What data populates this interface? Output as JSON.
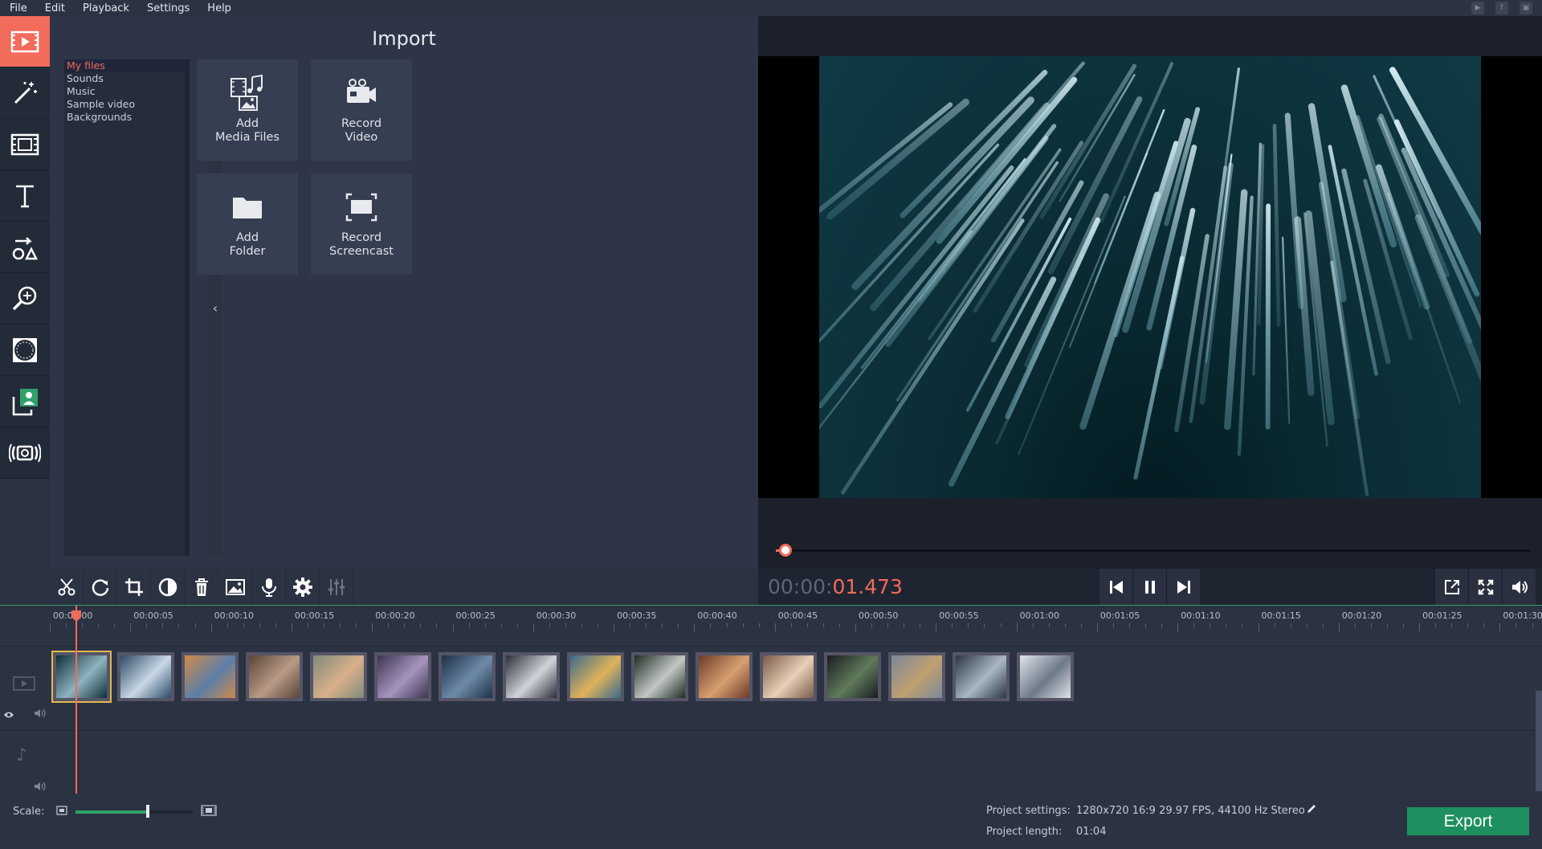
{
  "menu": {
    "items": [
      "File",
      "Edit",
      "Playback",
      "Settings",
      "Help"
    ]
  },
  "social_icons": [
    "youtube-icon",
    "facebook-icon",
    "vk-icon"
  ],
  "sidebar_tools": [
    {
      "name": "import-tool-icon",
      "active": true
    },
    {
      "name": "magic-wand-icon",
      "active": false
    },
    {
      "name": "filmstrip-filters-icon",
      "active": false
    },
    {
      "name": "titles-text-icon",
      "active": false
    },
    {
      "name": "shapes-callouts-icon",
      "active": false
    },
    {
      "name": "zoom-pan-icon",
      "active": false
    },
    {
      "name": "frame-mask-icon",
      "active": false
    },
    {
      "name": "chroma-person-icon",
      "active": false
    },
    {
      "name": "camera-stabilize-icon",
      "active": false
    }
  ],
  "import": {
    "title": "Import",
    "tree": [
      "My files",
      "Sounds",
      "Music",
      "Sample video",
      "Backgrounds"
    ],
    "tree_selected": 0,
    "collapse_glyph": "‹",
    "tiles": [
      {
        "line1": "Add",
        "line2": "Media Files",
        "icon": "add-media-icon"
      },
      {
        "line1": "Record",
        "line2": "Video",
        "icon": "video-camera-icon"
      },
      {
        "line1": "Add",
        "line2": "Folder",
        "icon": "folder-icon"
      },
      {
        "line1": "Record",
        "line2": "Screencast",
        "icon": "screencast-icon"
      }
    ]
  },
  "player": {
    "timecode_dim": "00:00:",
    "timecode_active": "01.473",
    "progress": 0.013
  },
  "edit_tools": [
    "scissors-icon",
    "rotate-icon",
    "crop-icon",
    "color-adjust-icon",
    "trash-icon",
    "image-icon",
    "microphone-icon",
    "gear-icon",
    "equalizer-icon"
  ],
  "timeline": {
    "ticks": [
      "00:00:00",
      "00:00:05",
      "00:00:10",
      "00:00:15",
      "00:00:20",
      "00:00:25",
      "00:00:30",
      "00:00:35",
      "00:00:40",
      "00:00:45",
      "00:00:50",
      "00:00:55",
      "00:01:00",
      "00:01:05",
      "00:01:10",
      "00:01:15",
      "00:01:20",
      "00:01:25",
      "00:01:30"
    ],
    "clips": [
      {
        "c1": "#0e2f38",
        "c2": "#8fb3bf"
      },
      {
        "c1": "#2c4a66",
        "c2": "#c9d8e6"
      },
      {
        "c1": "#d08a4a",
        "c2": "#5b7fa8"
      },
      {
        "c1": "#5a4438",
        "c2": "#b89a86"
      },
      {
        "c1": "#7f8a7a",
        "c2": "#d9b08a"
      },
      {
        "c1": "#3e3450",
        "c2": "#a595c0"
      },
      {
        "c1": "#1d3148",
        "c2": "#6f8aa8"
      },
      {
        "c1": "#2d2f38",
        "c2": "#d0d3da"
      },
      {
        "c1": "#3a6a8c",
        "c2": "#e0b25a"
      },
      {
        "c1": "#1f2c24",
        "c2": "#c3c8c4"
      },
      {
        "c1": "#6b3a2a",
        "c2": "#d8a070"
      },
      {
        "c1": "#7a5a48",
        "c2": "#e8d0b8"
      },
      {
        "c1": "#1a1c22",
        "c2": "#5f7a5a"
      },
      {
        "c1": "#7a8898",
        "c2": "#c0a070"
      },
      {
        "c1": "#2a3644",
        "c2": "#a9b8c6"
      },
      {
        "c1": "#dfe4ea",
        "c2": "#6e7a88"
      }
    ]
  },
  "status": {
    "scale_label": "Scale:",
    "project_settings_label": "Project settings:",
    "project_settings_value": "1280x720 16:9 29.97 FPS, 44100 Hz Stereo",
    "project_length_label": "Project length:",
    "project_length_value": "01:04",
    "export_label": "Export"
  },
  "colors": {
    "accent": "#f26b5b",
    "export_green": "#1e8f5f",
    "scale_green": "#2fa26a"
  }
}
